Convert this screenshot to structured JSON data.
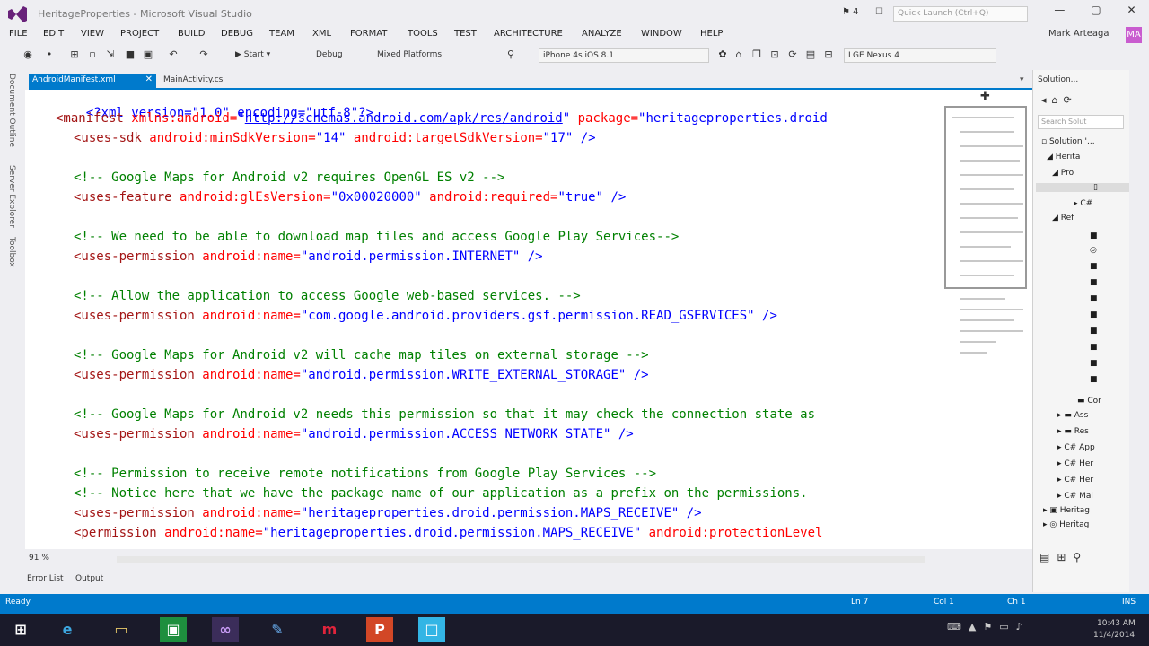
{
  "window": {
    "title": "HeritageProperties - Microsoft Visual Studio",
    "notification_count": "4",
    "quick_launch_placeholder": "Quick Launch (Ctrl+Q)",
    "controls": [
      "—",
      "▢",
      "✕"
    ]
  },
  "menu": [
    "FILE",
    "EDIT",
    "VIEW",
    "PROJECT",
    "BUILD",
    "DEBUG",
    "TEAM",
    "XML",
    "FORMAT",
    "TOOLS",
    "TEST",
    "ARCHITECTURE",
    "ANALYZE",
    "WINDOW",
    "HELP"
  ],
  "user": {
    "name": "Mark Arteaga",
    "avatar_initials": "MA"
  },
  "toolbar": {
    "start_label": "▶ Start ▾",
    "config": "Debug",
    "platform": "Mixed Platforms",
    "device": "iPhone 4s iOS 8.1",
    "target": "LGE Nexus 4"
  },
  "left_strip": [
    "Document Outline",
    "Server Explorer",
    "Toolbox"
  ],
  "doc_tabs": {
    "active": "AndroidManifest.xml",
    "active_close": "✕",
    "inactive": "MainActivity.cs",
    "dropdown": "▾"
  },
  "code": {
    "l1": "<?xml version=\"1.0\" encoding=\"utf-8\"?>",
    "l2_tag": "<manifest",
    "l2_attr": " xmlns:android=",
    "l2_q1": "\"",
    "l2_url": "http://schemas.android.com/apk/res/android",
    "l2_q2": "\"",
    "l2_attr2": " package=",
    "l2_val2": "\"heritageproperties.droid",
    "l3_tag": "<uses-sdk",
    "l3_attr1": " android:minSdkVersion=",
    "l3_val1": "\"14\"",
    "l3_attr2": " android:targetSdkVersion=",
    "l3_val2": "\"17\"",
    "l3_end": " />",
    "c1": "<!-- Google Maps for Android v2 requires OpenGL ES v2 -->",
    "l5_tag": "<uses-feature",
    "l5_attr1": " android:glEsVersion=",
    "l5_val1": "\"0x00020000\"",
    "l5_attr2": " android:required=",
    "l5_val2": "\"true\"",
    "l5_end": " />",
    "c2": "<!-- We need to be able to download map tiles and access Google Play Services-->",
    "p1_tag": "<uses-permission",
    "p1_attr": " android:name=",
    "p1_val": "\"android.permission.INTERNET\"",
    "p1_end": " />",
    "c3": "<!-- Allow the application to access Google web-based services. -->",
    "p2_tag": "<uses-permission",
    "p2_attr": " android:name=",
    "p2_val": "\"com.google.android.providers.gsf.permission.READ_GSERVICES\"",
    "p2_end": " />",
    "c4": "<!-- Google Maps for Android v2 will cache map tiles on external storage -->",
    "p3_tag": "<uses-permission",
    "p3_attr": " android:name=",
    "p3_val": "\"android.permission.WRITE_EXTERNAL_STORAGE\"",
    "p3_end": " />",
    "c5": "<!-- Google Maps for Android v2 needs this permission so that it may check the connection state as",
    "p4_tag": "<uses-permission",
    "p4_attr": " android:name=",
    "p4_val": "\"android.permission.ACCESS_NETWORK_STATE\"",
    "p4_end": " />",
    "c6": "<!-- Permission to receive remote notifications from Google Play Services -->",
    "c7": "<!-- Notice here that we have the package name of our application as a prefix on the permissions.",
    "p5_tag": "<uses-permission",
    "p5_attr": " android:name=",
    "p5_val": "\"heritageproperties.droid.permission.MAPS_RECEIVE\"",
    "p5_end": " />",
    "p6_tag": "<permission",
    "p6_attr": " android:name=",
    "p6_val": "\"heritageproperties.droid.permission.MAPS_RECEIVE\"",
    "p6_attr2": " android:protectionLevel"
  },
  "editor_foot": {
    "zoom": "91 %"
  },
  "tool_tabs": [
    "Error List",
    "Output"
  ],
  "solution_explorer": {
    "title": "Solution...",
    "search_placeholder": "Search Solut",
    "rows": [
      "Solution '...",
      "Herita",
      "Pro",
      "",
      "C#",
      "Ref",
      "",
      "",
      "",
      "",
      "",
      "",
      "Cor",
      "Ass",
      "Res",
      "App",
      "Her",
      "Her",
      "Mai",
      "Heritag",
      "Heritag"
    ]
  },
  "status_bar": {
    "ready": "Ready",
    "ln": "Ln 7",
    "col": "Col 1",
    "ch": "Ch 1",
    "mode": "INS"
  },
  "taskbar": {
    "time": "10:43 AM",
    "date": "11/4/2014"
  },
  "colors": {
    "accent": "#007acc",
    "xml_tag": "#a31515",
    "xml_attr": "#ff0000",
    "xml_value": "#0000ff",
    "comment": "#008000"
  }
}
